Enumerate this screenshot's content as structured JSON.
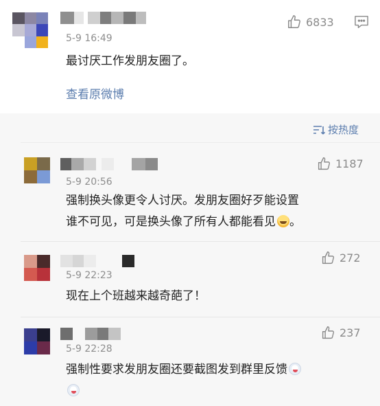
{
  "top_comment": {
    "time": "5-9 16:49",
    "likes": "6833",
    "text": "最讨厌工作发朋友圈了。",
    "view_original": "查看原微博"
  },
  "sort_label": "按热度",
  "replies": [
    {
      "time": "5-9 20:56",
      "likes": "1187",
      "text_line1": "强制换头像更令人讨厌。发朋友圈好歹能设置",
      "text_line2": "谁不可见，可是换头像了所有人都能看见",
      "text_line2_end": "。"
    },
    {
      "time": "5-9 22:23",
      "likes": "272",
      "text": "现在上个班越来越奇葩了！"
    },
    {
      "time": "5-9 22:28",
      "likes": "237",
      "text": "强制性要求发朋友圈还要截图发到群里反馈"
    }
  ],
  "colors": {
    "link": "#5b7dae",
    "time": "#8d8d8d",
    "text": "#222222",
    "gray_bg": "#f7f7f7"
  },
  "icons": [
    "thumbs-up-icon",
    "comment-icon",
    "sort-icon",
    "laughing-emoji-icon",
    "crying-emoji-icon"
  ]
}
